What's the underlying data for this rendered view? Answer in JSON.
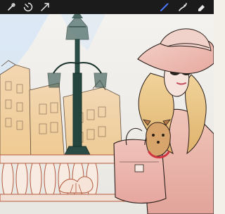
{
  "app": {
    "toolbar": {
      "left_tools": [
        "adjustments-icon",
        "selection-icon",
        "transform-arrow-icon"
      ],
      "right_tools": [
        "brush-icon",
        "smudge-icon",
        "eraser-icon"
      ],
      "active_tool": "brush-icon",
      "active_color": "#4a78ff"
    },
    "canvas": {
      "artwork": "illustration"
    }
  }
}
